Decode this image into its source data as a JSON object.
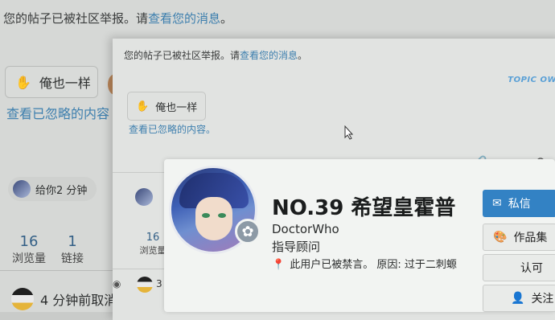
{
  "back": {
    "notice_prefix": "您的帖子已被社区举报。请",
    "notice_link": "查看您的消息",
    "notice_suffix": "。",
    "metoo_label": "俺也一样",
    "ignored_link": "查看已忽略的内容",
    "gift_label": "给你2 分钟",
    "stats": [
      {
        "num": "16",
        "label": "浏览量"
      },
      {
        "num": "1",
        "label": "链接"
      }
    ],
    "recent_label": "4 分钟前取消"
  },
  "front": {
    "notice_prefix": "您的帖子已被社区举报。请",
    "notice_link": "查看您的消息",
    "notice_suffix": "。",
    "topic_tag": "TOPIC OW",
    "metoo_label": "俺也一样",
    "ignored_link": "查看已忽略的内容。",
    "stats": [
      {
        "num": "16",
        "label": "浏览量"
      }
    ],
    "reply_count": "3"
  },
  "card": {
    "title": "NO.39 希望皇霍普",
    "username": "DoctorWho",
    "role": "指导顾问",
    "suspend_text": "此用户已被禁言。 原因:  过于二刺螈",
    "buttons": {
      "message": "私信",
      "works": "作品集",
      "approve": "认可",
      "follow": "关注"
    }
  },
  "icons": [
    "hand-icon",
    "link-icon",
    "more-icon",
    "reply-icon",
    "eye-icon",
    "mail-icon",
    "palette-icon",
    "follow-icon",
    "flower-icon",
    "pin-icon",
    "cursor-icon"
  ]
}
